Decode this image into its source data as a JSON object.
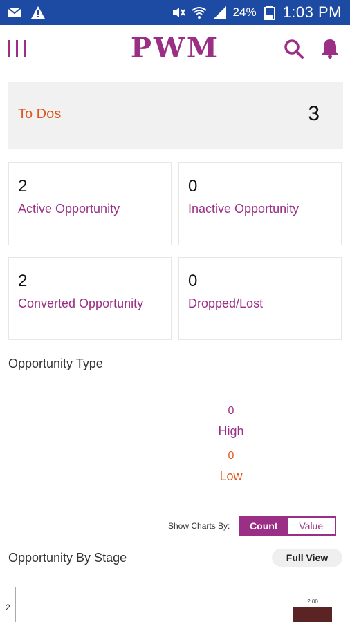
{
  "status_bar": {
    "icons": [
      "mail-icon",
      "warning-icon",
      "mute-icon",
      "wifi-icon",
      "signal-icon",
      "battery-icon"
    ],
    "battery": "24%",
    "time": "1:03 PM"
  },
  "app_bar": {
    "title": "PWM",
    "icons": [
      "menu-icon",
      "search-icon",
      "bell-icon"
    ]
  },
  "todos": {
    "label": "To Dos",
    "count": "3"
  },
  "stats": [
    {
      "value": "2",
      "label": "Active Opportunity"
    },
    {
      "value": "0",
      "label": "Inactive Opportunity"
    },
    {
      "value": "2",
      "label": "Converted Opportunity"
    },
    {
      "value": "0",
      "label": "Dropped/Lost"
    }
  ],
  "opportunity_type": {
    "title": "Opportunity Type",
    "legend": [
      {
        "value": "0",
        "label": "High"
      },
      {
        "value": "0",
        "label": "Low"
      }
    ]
  },
  "show_charts": {
    "label": "Show Charts By:",
    "options": [
      "Count",
      "Value"
    ],
    "selected": "Count"
  },
  "opportunity_stage": {
    "title": "Opportunity By Stage",
    "full_view_label": "Full View"
  },
  "colors": {
    "brand": "#9b2f86",
    "accent": "#e0561c",
    "status_bar": "#1d4aa3",
    "bar": "#5a2424"
  },
  "chart_data": {
    "type": "bar",
    "categories": [
      ""
    ],
    "values": [
      2
    ],
    "data_labels": [
      "2.00"
    ],
    "y_ticks": [
      "2"
    ],
    "ylim": [
      0,
      2
    ]
  }
}
